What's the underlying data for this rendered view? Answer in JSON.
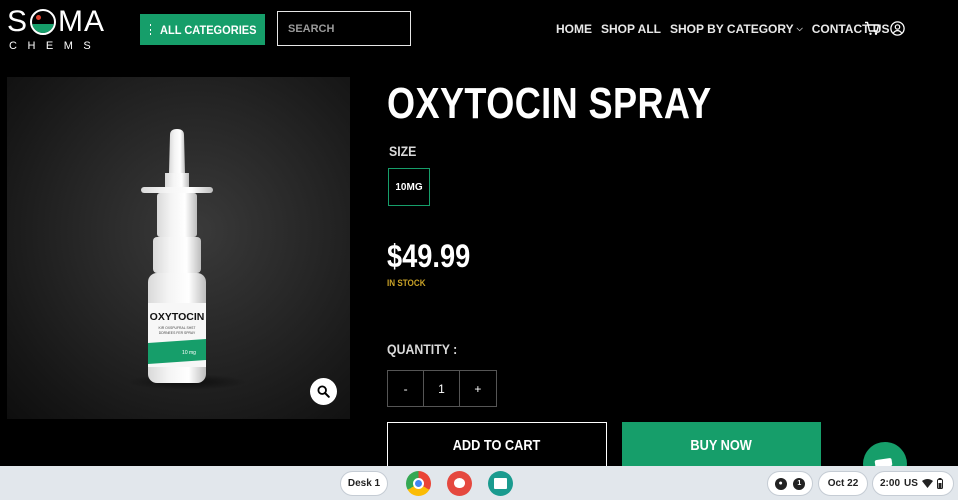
{
  "header": {
    "logo_main_left": "S",
    "logo_main_right": "MA",
    "logo_sub": "CHEMS",
    "categories_label": "ALL CATEGORIES",
    "search_placeholder": "SEARCH",
    "nav": {
      "home": "HOME",
      "shop_all": "SHOP ALL",
      "shop_by_category": "SHOP BY CATEGORY",
      "contact": "CONTACT US"
    },
    "icons": [
      "menu-icon",
      "cart-icon",
      "account-icon",
      "chevron-down-icon"
    ]
  },
  "product": {
    "title": "OXYTOCIN SPRAY",
    "size_label": "SIZE",
    "size_option": "10MG",
    "price": "$49.99",
    "stock_status": "IN STOCK",
    "quantity_label": "QUANTITY :",
    "quantity_minus": "-",
    "quantity_value": "1",
    "quantity_plus": "+",
    "add_to_cart": "ADD TO CART",
    "buy_now": "BUY NOW",
    "image": {
      "bottle_name": "OXYTOCIN",
      "bottle_line1": "KIR OXSPUFRAL SHST",
      "bottle_line2": "DDRNEES FER SPRAY",
      "bottle_dose": "10 mg"
    }
  },
  "colors": {
    "accent": "#169e6a",
    "background": "#000000",
    "stock": "#c9a227"
  },
  "shelf": {
    "desk_label": "Desk 1",
    "apps": [
      "chrome-icon",
      "palette-icon",
      "classroom-icon"
    ],
    "notification_count": "1",
    "date": "Oct 22",
    "time": "2:00",
    "locale": "US"
  }
}
